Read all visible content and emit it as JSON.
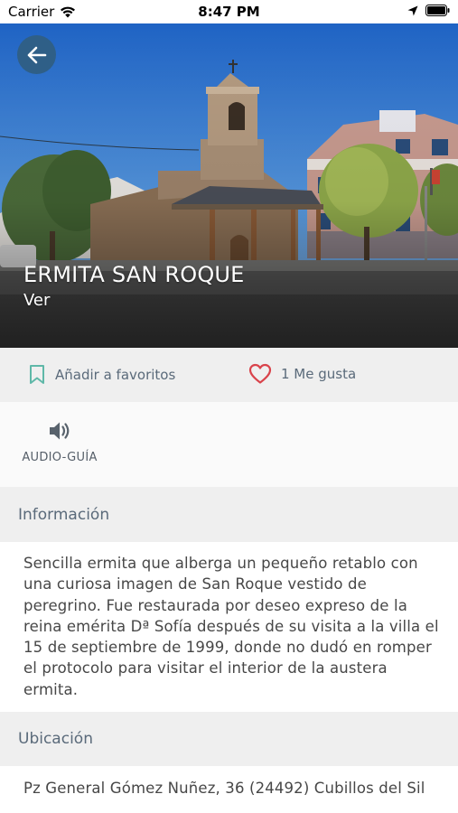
{
  "status_bar": {
    "carrier": "Carrier",
    "time": "8:47 PM"
  },
  "hero": {
    "title": "ERMITA SAN ROQUE",
    "subtitle": "Ver"
  },
  "actions": {
    "favorite_label": "Añadir a favoritos",
    "like_label": "1 Me gusta"
  },
  "audio": {
    "label": "AUDIO-GUÍA"
  },
  "info": {
    "header": "Información",
    "text": "Sencilla ermita que alberga un pequeño retablo con una curiosa imagen de San Roque vestido de peregrino. Fue restaurada por deseo expreso de la reina emérita Dª Sofía después de su visita a la villa el 15 de septiembre de 1999, donde no dudó en romper el protocolo para visitar el interior de la austera ermita."
  },
  "location": {
    "header": "Ubicación",
    "address": "Pz General Gómez Nuñez, 36 (24492) Cubillos del Sil"
  },
  "colors": {
    "accent": "#2f5f87",
    "heart": "#d9434b",
    "bookmark": "#5fb8a8"
  }
}
